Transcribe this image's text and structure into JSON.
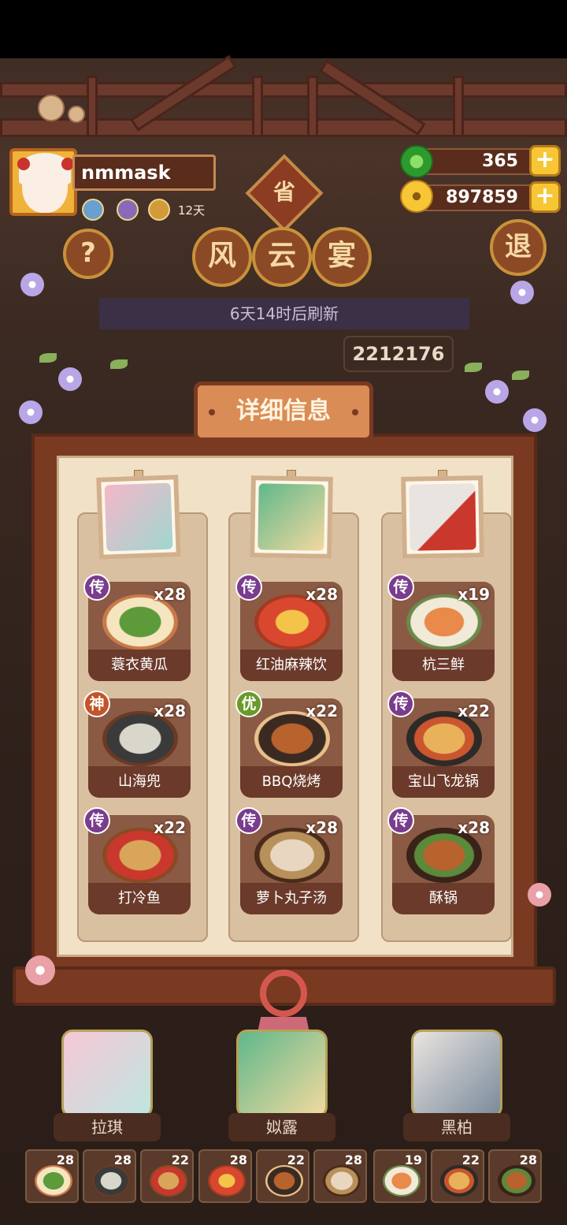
{
  "player": {
    "name": "nmmask",
    "days": "12天"
  },
  "currency": {
    "jade": "365",
    "coins": "897859"
  },
  "event": {
    "province_label": "省",
    "title_chars": [
      "风",
      "云",
      "宴"
    ],
    "refresh_text": "6天14时后刷新",
    "score": "2212176",
    "help_label": "?",
    "exit_label": "退"
  },
  "details": {
    "header": "详细信息",
    "columns": [
      {
        "portrait_colors": [
          "#f6b7c8",
          "#9fd7d0"
        ],
        "dishes": [
          {
            "name": "蓑衣黄瓜",
            "rarity": "传",
            "qty": "x28",
            "rarity_color": "#7a3c8c",
            "food_color": "#5c9a3a"
          },
          {
            "name": "山海兜",
            "rarity": "神",
            "qty": "x28",
            "rarity_color": "#c4542a",
            "food_color": "#d9d6cc"
          },
          {
            "name": "打冷鱼",
            "rarity": "传",
            "qty": "x22",
            "rarity_color": "#7a3c8c",
            "food_color": "#d9a55a"
          }
        ]
      },
      {
        "portrait_colors": [
          "#5fb88a",
          "#f3d9a0"
        ],
        "dishes": [
          {
            "name": "红油麻辣饮",
            "rarity": "传",
            "qty": "x28",
            "rarity_color": "#7a3c8c",
            "food_color": "#d9482e"
          },
          {
            "name": "BBQ烧烤",
            "rarity": "优",
            "qty": "x22",
            "rarity_color": "#6a9a2a",
            "food_color": "#b8622e"
          },
          {
            "name": "萝卜丸子汤",
            "rarity": "传",
            "qty": "x28",
            "rarity_color": "#7a3c8c",
            "food_color": "#e9d6c0"
          }
        ]
      },
      {
        "portrait_colors": [
          "#e9e4e0",
          "#c9372d"
        ],
        "dishes": [
          {
            "name": "杭三鲜",
            "rarity": "传",
            "qty": "x19",
            "rarity_color": "#7a3c8c",
            "food_color": "#e98a4a"
          },
          {
            "name": "宝山飞龙锅",
            "rarity": "传",
            "qty": "x22",
            "rarity_color": "#7a3c8c",
            "food_color": "#e9b25a"
          },
          {
            "name": "酥锅",
            "rarity": "传",
            "qty": "x28",
            "rarity_color": "#7a3c8c",
            "food_color": "#b8622e"
          }
        ]
      }
    ]
  },
  "characters": [
    {
      "name": "拉琪",
      "colors": [
        "#f6c7d6",
        "#bfe6e0"
      ]
    },
    {
      "name": "姒露",
      "colors": [
        "#5fb88a",
        "#f3d9a0"
      ]
    },
    {
      "name": "黑柏",
      "colors": [
        "#e9e4e0",
        "#7a8a9a"
      ]
    }
  ],
  "dish_bar": [
    {
      "qty": "28",
      "color": "#5c9a3a"
    },
    {
      "qty": "28",
      "color": "#d9d6cc"
    },
    {
      "qty": "22",
      "color": "#d9a55a"
    },
    {
      "qty": "28",
      "color": "#d9482e"
    },
    {
      "qty": "22",
      "color": "#b8622e"
    },
    {
      "qty": "28",
      "color": "#e9d6c0"
    },
    {
      "qty": "19",
      "color": "#e98a4a"
    },
    {
      "qty": "22",
      "color": "#e9b25a"
    },
    {
      "qty": "28",
      "color": "#b8622e"
    }
  ]
}
